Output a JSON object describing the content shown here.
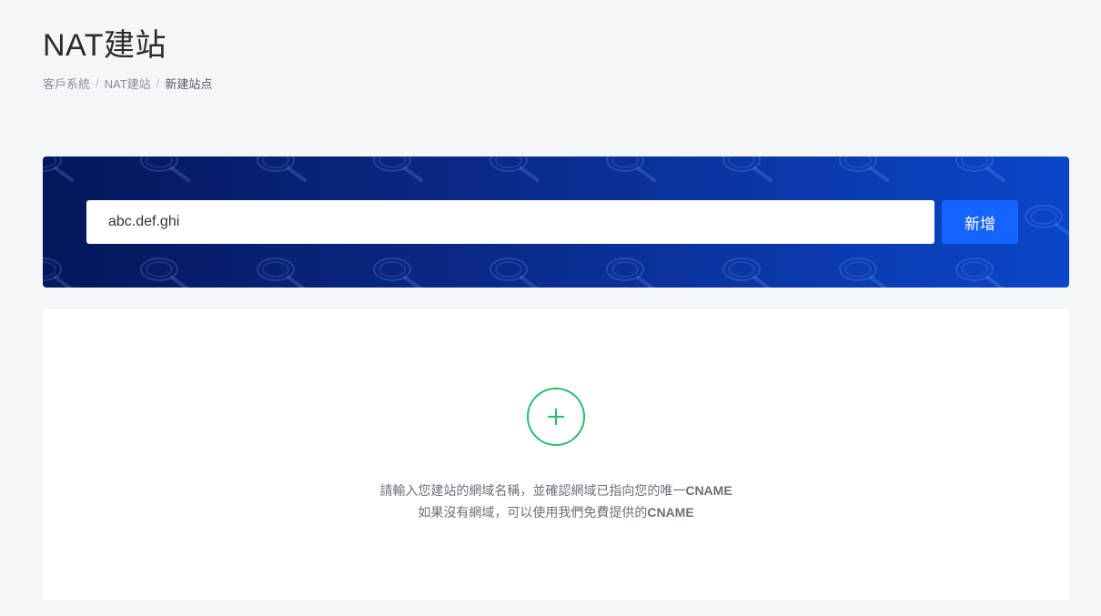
{
  "page": {
    "title": "NAT建站",
    "breadcrumb": [
      {
        "label": "客戶系統"
      },
      {
        "label": "NAT建站"
      },
      {
        "label": "新建站点"
      }
    ],
    "breadcrumb_separator": "/"
  },
  "hero": {
    "input_value": "abc.def.ghi",
    "button_label": "新增",
    "background_pattern_icon": "search-icon",
    "colors": {
      "start": "#04175a",
      "end": "#0a46c9",
      "button": "#1664ff"
    }
  },
  "empty_state": {
    "icon": "plus-circle-icon",
    "icon_color": "#2bbd6a",
    "line1_text": "請輸入您建站的網域名稱，並確認網域已指向您的唯一",
    "line1_bold": "CNAME",
    "line2_text": "如果沒有網域，可以使用我們免費提供的",
    "line2_bold": "CNAME"
  }
}
